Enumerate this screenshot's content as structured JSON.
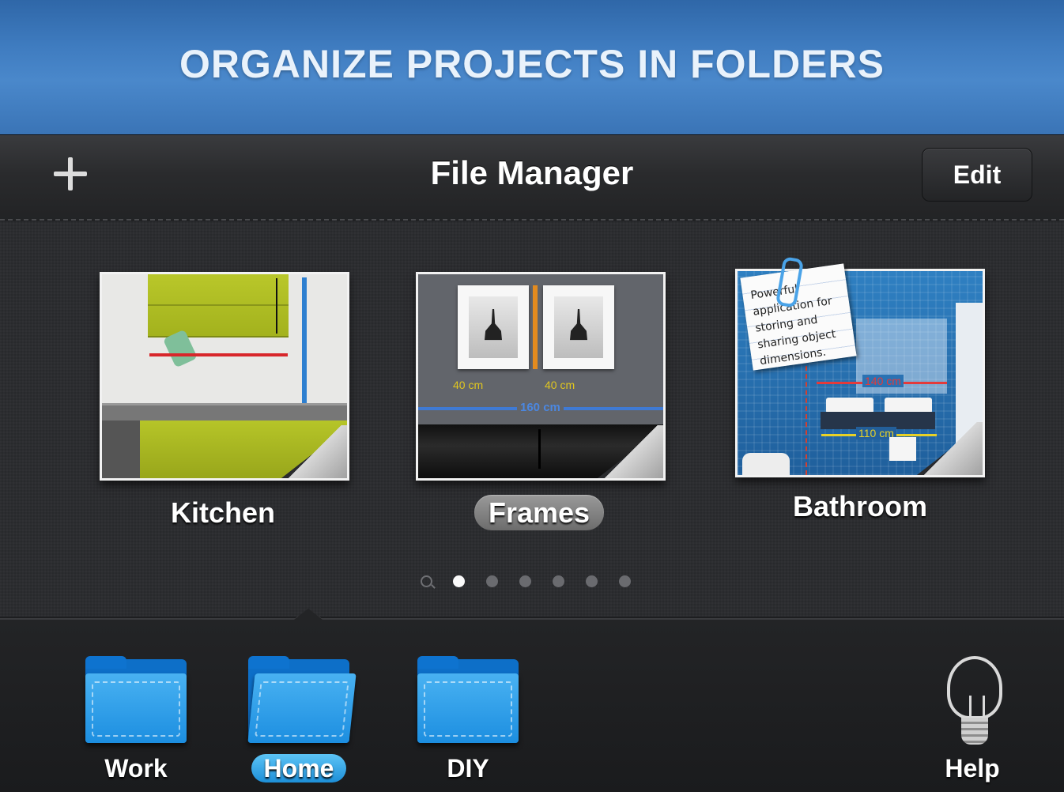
{
  "banner": {
    "title": "ORGANIZE PROJECTS IN FOLDERS"
  },
  "navbar": {
    "title": "File Manager",
    "edit_label": "Edit",
    "add_icon": "plus-icon"
  },
  "projects": [
    {
      "name": "Kitchen",
      "selected": false
    },
    {
      "name": "Frames",
      "selected": true,
      "labels": {
        "left": "40 cm",
        "right": "40 cm",
        "width": "160 cm"
      }
    },
    {
      "name": "Bathroom",
      "selected": false,
      "note": "Powerful application for storing and sharing object dimensions.",
      "labels": {
        "width": "140 cm",
        "counter": "110 cm"
      }
    }
  ],
  "pager": {
    "pages": 6,
    "active": 0,
    "search_icon": "search-icon"
  },
  "folders": [
    {
      "name": "Work",
      "selected": false
    },
    {
      "name": "Home",
      "selected": true
    },
    {
      "name": "DIY",
      "selected": false
    }
  ],
  "help": {
    "label": "Help",
    "icon": "lightbulb-icon"
  },
  "colors": {
    "banner": "#3f7cc0",
    "folder": "#1c8ee0",
    "selected_folder_pill": "#3aa8ee"
  }
}
